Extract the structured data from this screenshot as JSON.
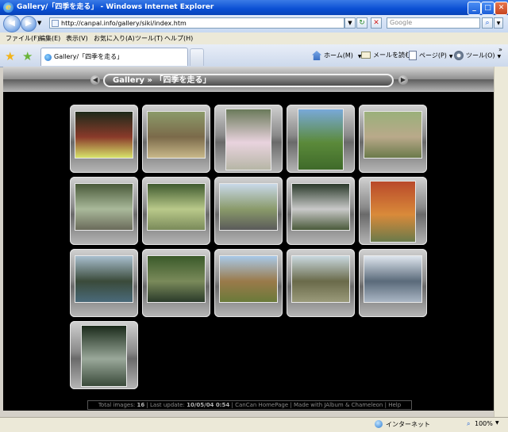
{
  "window": {
    "title": "Gallery/「四季を走る」 - Windows Internet Explorer",
    "controls": {
      "minimize": "_",
      "maximize": "□",
      "close": "✕"
    }
  },
  "toolbar": {
    "back": "◀",
    "forward": "▶",
    "address": "http://canpal.info/gallery/siki/index.htm",
    "refresh": "↻",
    "stop": "✕",
    "search_placeholder": "Google",
    "search_go": "⌕"
  },
  "menu": [
    "ファイル(F)",
    "編集(E)",
    "表示(V)",
    "お気に入り(A)",
    "ツール(T)",
    "ヘルプ(H)"
  ],
  "tabs": {
    "active": "Gallery/「四季を走る」"
  },
  "commandbar": {
    "home": "ホーム(M)",
    "read_mail": "メールを読む",
    "page": "ページ(P)",
    "tools": "ツール(O)"
  },
  "gallery": {
    "title": "Gallery » 「四季を走る」",
    "prev": "◀",
    "next": "▶",
    "thumbnails": [
      {
        "name": "photo-01",
        "orient": "landscape",
        "colors": [
          "#1d2a1a",
          "#8a3a2a",
          "#d8e36a"
        ]
      },
      {
        "name": "photo-02",
        "orient": "landscape",
        "colors": [
          "#8b9a6a",
          "#7b6a4a",
          "#c9b98a"
        ]
      },
      {
        "name": "photo-03",
        "orient": "portrait",
        "colors": [
          "#6a7a5a",
          "#e9d3de",
          "#b6b6a6"
        ]
      },
      {
        "name": "photo-04",
        "orient": "portrait",
        "colors": [
          "#79a9d9",
          "#5b8a3a",
          "#3f6a2a"
        ]
      },
      {
        "name": "photo-05",
        "orient": "landscape",
        "colors": [
          "#9ab07a",
          "#b9a98a",
          "#6a7a4a"
        ]
      },
      {
        "name": "photo-06",
        "orient": "landscape",
        "colors": [
          "#4a5a3a",
          "#a9b99a",
          "#6a6a5a"
        ]
      },
      {
        "name": "photo-07",
        "orient": "landscape",
        "colors": [
          "#3f5a2f",
          "#b9c98a",
          "#7a8a5a"
        ]
      },
      {
        "name": "photo-08",
        "orient": "landscape",
        "colors": [
          "#c9d9e9",
          "#8a9a6a",
          "#5a5a5a"
        ]
      },
      {
        "name": "photo-09",
        "orient": "landscape",
        "colors": [
          "#2a3a2a",
          "#c9c9c9",
          "#4a5a3a"
        ]
      },
      {
        "name": "photo-10",
        "orient": "portrait",
        "colors": [
          "#b9492a",
          "#d98a3a",
          "#6a7a4a"
        ]
      },
      {
        "name": "photo-11",
        "orient": "landscape",
        "colors": [
          "#aac0d0",
          "#3a4a3a",
          "#4a6a7a"
        ]
      },
      {
        "name": "photo-12",
        "orient": "landscape",
        "colors": [
          "#3a5a2a",
          "#7a8a5a",
          "#2a3a2a"
        ]
      },
      {
        "name": "photo-13",
        "orient": "landscape",
        "colors": [
          "#a9c9e9",
          "#9a7a4a",
          "#6a7a3a"
        ]
      },
      {
        "name": "photo-14",
        "orient": "landscape",
        "colors": [
          "#c9d9e0",
          "#6a6a4a",
          "#9a9a7a"
        ]
      },
      {
        "name": "photo-15",
        "orient": "landscape",
        "colors": [
          "#dfe6ee",
          "#5a6a7a",
          "#aab6c4"
        ]
      },
      {
        "name": "photo-16",
        "orient": "portrait",
        "colors": [
          "#1a2a1a",
          "#9aa89a",
          "#3a4a3a"
        ]
      }
    ]
  },
  "footer": {
    "total_label": "Total images:",
    "total_value": "16",
    "update_label": "| Last update:",
    "update_value": "10/05/04 0:54",
    "homepage": "| CanCan HomePage",
    "made_with": "| Made with JAlbum & Chameleon",
    "help": "| Help"
  },
  "status": {
    "zone": "インターネット",
    "zoom": "100%"
  }
}
